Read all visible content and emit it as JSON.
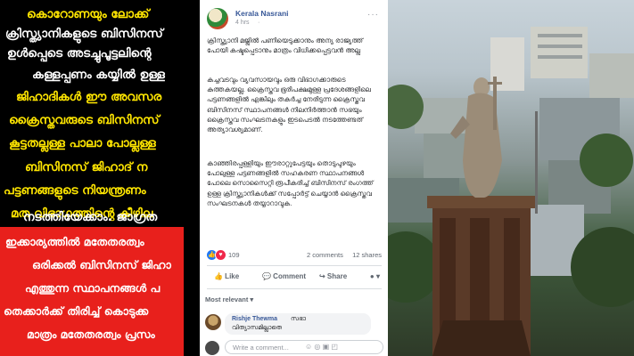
{
  "left_panel": {
    "lines": [
      "കൊറോണയും ലോക്ക്",
      "ക്രിസ്ത്യാനികളുടെ ബിസിനസ്",
      "ഉൾപ്പെടെ അടച്ചുപൂട്ടലിന്റെ",
      "കള്ളപ്പണം കയ്യിൽ ഉള്ള",
      "ജിഹാദികൾ ഈ അവസര",
      "ക്രൈസ്തവരുടെ ബിസിനസ്",
      "കൂട്ടതല്ലള്ള പാലാ പോല്ലള്ള",
      "ബിസിനസ് ജിഹാദ് ന",
      "പട്ടണങ്ങളുടെ നിയന്ത്രണം",
      "മത വിഭാഗത്തിന്റെ കീഴില",
      "നടത്തിയേക്കാം. ജാഗ്രത"
    ],
    "red_lines": [
      "ഇക്കാര്യത്തിൽ മതേതരത്വം",
      "ഒരിക്കൽ ബിസിനസ് ജിഹാ",
      "എത്തുന്ന സ്ഥാപനങ്ങൾ പ",
      "തെക്കാർക്ക് തിരിച്ച് കൊടുക്ക",
      "മാത്രം മതേതരത്വം പ്രസം"
    ]
  },
  "post": {
    "author": "Kerala Nasrani",
    "time": "4 hrs",
    "globe_icon": "·",
    "more": "···",
    "paragraphs": [
      "ക്രിസ്ത്യാനി മജ്ലിൽ പണിയെടുക്കാനും അന്യ രാജ്യത്ത് പോയി കഷ്ടപ്പെടാനും മാത്രം വിധിക്കപ്പെട്ടവൻ അല്ല",
      "കച്ചവടവും വ്യവസായവും ഒരു വിഭാഗക്കാരുടെ കുത്തകയല്ല. ക്രൈസ്തവ ഭൂരിപക്ഷമുള്ള പ്രദേശങ്ങളിലെ പട്ടണങ്ങളിൽ എങ്കിലും തകർച്ച നേരിടുന്ന ക്രൈസ്തവ ബിസിനസ് സ്ഥാപനങ്ങൾ നിലനിർത്താൻ സഭയും ക്രൈസ്തവ സംഘടനകളും ഇടപെടൽ നടത്തേണ്ടത് അത്യാവശ്യമാണ്.",
      "കാഞ്ഞിരപ്പള്ളിയും ഈരാറ്റുപേട്ടയും തൊടുപുഴയും പോലുള്ള പട്ടണങ്ങളിൽ സഹകരണ സ്ഥാപനങ്ങൾ പോലെ സൊസൈറ്റി രൂപീകരിച്ച് ബിസിനസ് രംഗത്ത് ഉള്ള ക്രിസ്ത്യാനികൾക്ക് സപ്പോർട്ട് ചെയ്യാൻ ക്രൈസ്തവ സംഘടനകൾ തയ്യാറാവുക."
    ],
    "reactions": {
      "like_icon": "👍",
      "love_icon": "♥",
      "count": "109",
      "comments": "2 comments",
      "shares": "12 shares"
    },
    "actions": {
      "like": "👍 Like",
      "comment": "💬 Comment",
      "share": "↪ Share",
      "menu": "● ▾"
    },
    "most_relevant": "Most relevant ▾",
    "comment": {
      "name": "Rishje Thewma",
      "text1": "സഭാ",
      "text2": "വിത്യാസമില്ലാതെ"
    },
    "write_placeholder": "Write a comment...",
    "write_icons": "☺  ◎  ▣  ◰"
  },
  "colors": {
    "yellow_text": "#ffe600",
    "red_band": "#e8201c",
    "fb_link": "#385898",
    "like_blue": "#2078f4",
    "love_red": "#f0284a"
  }
}
